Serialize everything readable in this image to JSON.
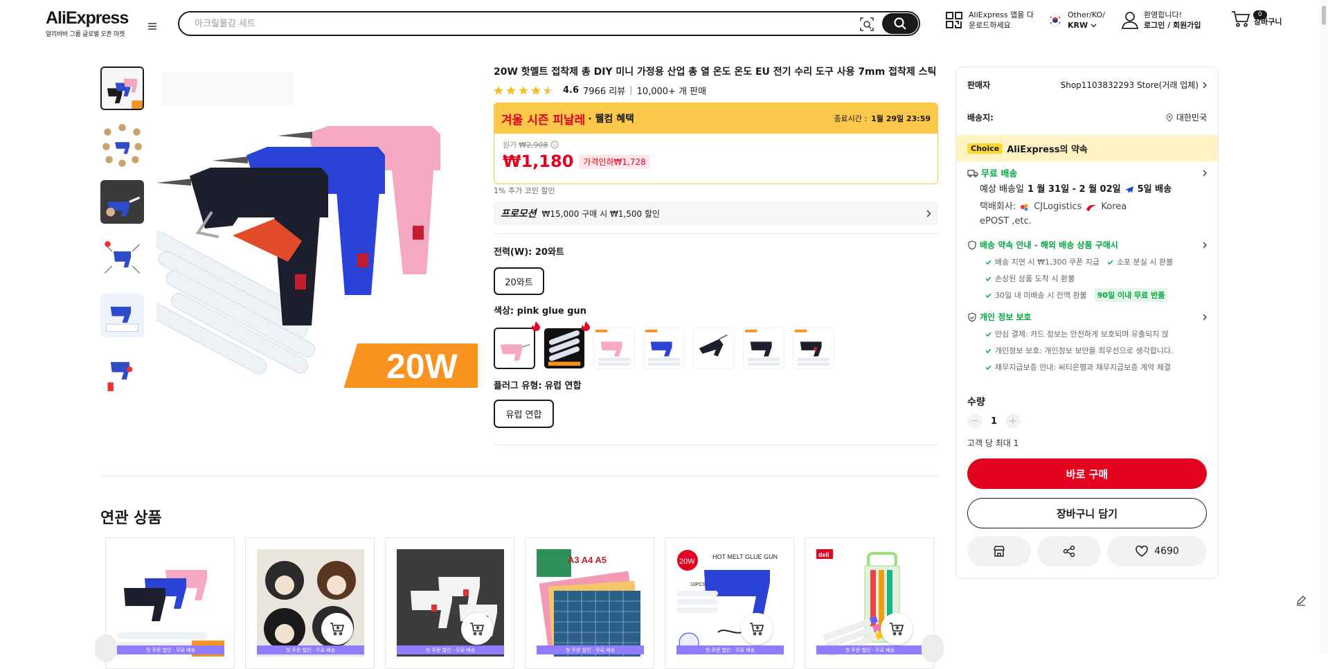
{
  "header": {
    "logo_name": "AliExpress",
    "logo_tagline": "알리바바 그룹 글로벌 오픈 마켓",
    "search_placeholder": "아크릴물감 세트",
    "app_line1": "AliExpress 앱을 다",
    "app_line2": "운로드하세요",
    "region_line1": "Other/KO/",
    "region_line2": "KRW",
    "account_line1": "환영합니다!",
    "account_line2": "로그인 / 회원가입",
    "cart_count": "0",
    "cart_label": "장바구니"
  },
  "product": {
    "title": "20W 핫멜트 접착제 총 DIY 미니 가정용 산업 총 열 온도 온도 EU 전기 수리 도구 사용 7mm 접착제 스틱",
    "rating": "4.6",
    "reviews": "7966 리뷰",
    "sold": "10,000+ 개 판매",
    "rating_value": 4.6,
    "sale_name": "겨울 시즌 피날레",
    "sale_benefit": "· 웰컴 혜택",
    "end_label": "종료시간 :",
    "end_time": "1월 29일 23:59",
    "orig_label": "원가",
    "orig_price": "₩2,908",
    "price": "₩1,180",
    "discount_badge": "가격인하₩1,728",
    "coin_note": "1% 추가 코인 할인",
    "promo_label": "프로모션",
    "promo_text": "₩15,000 구매 시 ₩1,500 할인",
    "power_label": "전력(W): 20와트",
    "power_option": "20와트",
    "color_label": "색상: pink glue gun",
    "plug_label": "플러그 유형: 유럽 연합",
    "plug_option": "유럽 연합",
    "main_badge": "20W"
  },
  "panel": {
    "seller_label": "판매자",
    "seller_value": "Shop1103832293 Store(거래 업체)",
    "ship_to_label": "배송지:",
    "ship_to_value": "대한민국",
    "choice_badge": "Choice",
    "choice_text": "AliExpress의 약속",
    "free_ship": "무료 배송",
    "eta_prefix": "예상 배송일",
    "eta_range": "1 월 31일 - 2 월 02일",
    "eta_days": "5일 배송",
    "carrier_label": "택배회사:",
    "carrier_1": "CJLogistics",
    "carrier_2": "Korea",
    "carrier_3": "ePOST ,etc.",
    "guarantee_title": "배송 약속 안내 - 해외 배송 상품 구매시",
    "g1a": "배송 지연 시 ₩1,300 쿠폰 지급",
    "g1b": "소포 분실 시 환불",
    "g2": "손상된 상품 도착 시 환불",
    "g3": "30일 내 미배송 시 전액 환불",
    "g3_badge": "90일 이내 무료 반품",
    "privacy_title": "개인 정보 보호",
    "p1": "안심 결제: 카드 정보는 안전하게 보호되며 유출되지 않",
    "p2": "개인정보 보호: 개인정보 보안을 최우선으로 생각합니다.",
    "p3": "채무지급보증 안내: 씨티은행과 채무지급보증 계약 체결",
    "qty_label": "수량",
    "qty_value": "1",
    "limit": "고객 당 최대 1",
    "buy_now": "바로 구매",
    "add_cart": "장바구니 담기",
    "wishlist_count": "4690"
  },
  "related": {
    "title": "연관 상품",
    "banner_text": "첫 주문 할인 · 무료 배송",
    "card4_label": "A3 A4 A5",
    "card5_badge": "20W",
    "card5_label": "HOT MELT GLUE GUN",
    "card5_sub": "10PCS",
    "card6_badge": "deli"
  },
  "colors": {
    "accent_red": "#e3021f",
    "sale_yellow": "#fbc84a",
    "choice_yellow": "#fff0b8",
    "green": "#00a642",
    "dark": "#191919"
  }
}
